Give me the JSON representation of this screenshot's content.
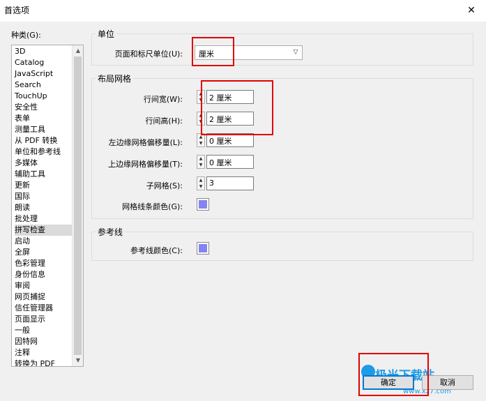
{
  "window": {
    "title": "首选项",
    "close_glyph": "✕"
  },
  "categories": {
    "label": "种类(G):",
    "selected_index": 16,
    "items": [
      "3D",
      "Catalog",
      "JavaScript",
      "Search",
      "TouchUp",
      "安全性",
      "表单",
      "测量工具",
      "从 PDF 转换",
      "单位和参考线",
      "多媒体",
      "辅助工具",
      "更新",
      "国际",
      "朗读",
      "批处理",
      "拼写检查",
      "启动",
      "全屏",
      "色彩管理",
      "身份信息",
      "审阅",
      "网页捕捉",
      "信任管理器",
      "页面显示",
      "一般",
      "因特网",
      "注释",
      "转换为 PDF"
    ]
  },
  "units_group": {
    "title": "单位",
    "page_ruler_label": "页面和标尺单位(U):",
    "page_ruler_value": "厘米"
  },
  "grid_group": {
    "title": "布局网格",
    "fields": [
      {
        "label": "行间宽(W):",
        "value": "2 厘米"
      },
      {
        "label": "行间高(H):",
        "value": "2 厘米"
      },
      {
        "label": "左边缘网格偏移量(L):",
        "value": "0 厘米"
      },
      {
        "label": "上边缘网格偏移量(T):",
        "value": "0 厘米"
      },
      {
        "label": "子网格(S):",
        "value": "3"
      }
    ],
    "color_label": "网格线条颜色(G):",
    "color": "#8484f0"
  },
  "guides_group": {
    "title": "参考线",
    "color_label": "参考线颜色(C):",
    "color": "#8484f0"
  },
  "buttons": {
    "ok": "确定",
    "cancel": "取消"
  },
  "watermark": {
    "text": "极光下载站",
    "url": "www.xz7.com"
  }
}
